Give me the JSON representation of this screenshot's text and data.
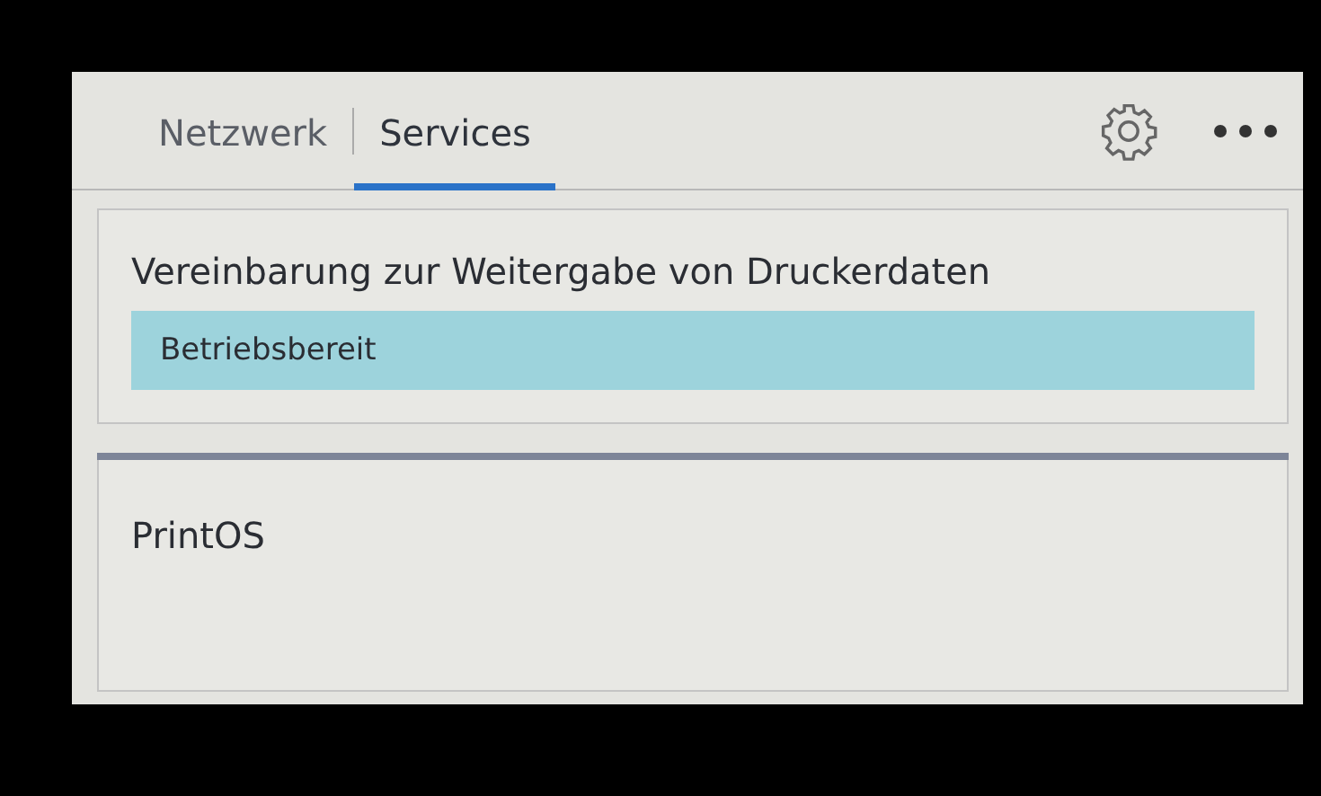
{
  "tabs": [
    {
      "label": "Netzwerk",
      "selected": false
    },
    {
      "label": "Services",
      "selected": true
    }
  ],
  "sections": [
    {
      "title": "Vereinbarung zur Weitergabe von Druckerdaten",
      "items": [
        {
          "label": "Betriebsbereit",
          "selected": true
        }
      ]
    },
    {
      "title": "PrintOS"
    }
  ]
}
